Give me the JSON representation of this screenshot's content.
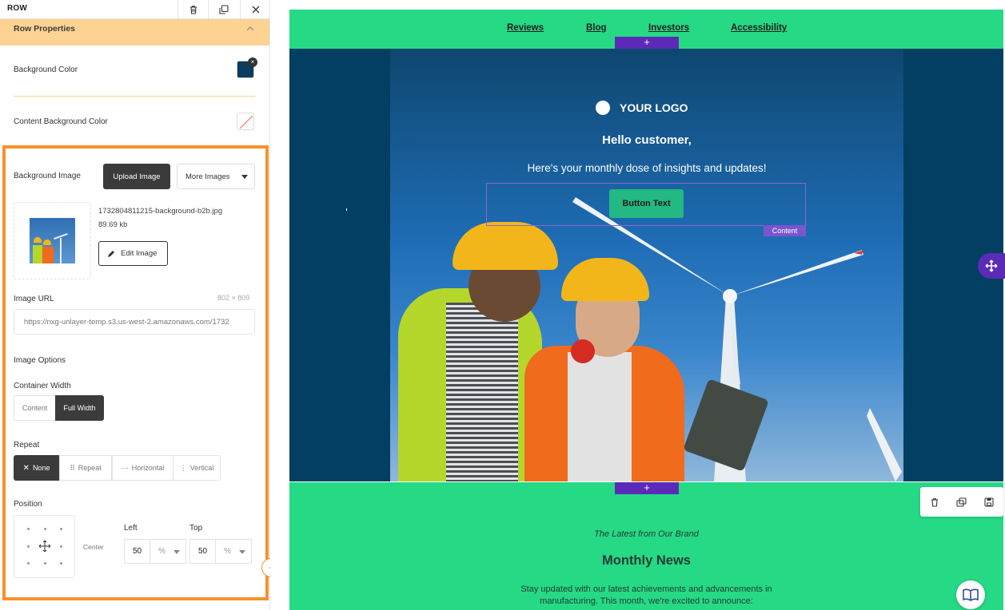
{
  "panel": {
    "title": "ROW",
    "section_title": "Row Properties",
    "background_color_label": "Background Color",
    "background_color_value": "#0b3d5e",
    "content_bg_label": "Content Background Color",
    "bg_image_label": "Background Image",
    "upload_label": "Upload Image",
    "more_images_label": "More Images",
    "file_name": "1732804811215-background-b2b.jpg",
    "file_size": "89.69 kb",
    "edit_image_label": "Edit Image",
    "image_url_label": "Image URL",
    "image_dimensions": "802 × 809",
    "image_url_value": "https://nxg-unlayer-temp.s3.us-west-2.amazonaws.com/1732",
    "image_options_label": "Image Options",
    "container_width_label": "Container Width",
    "container_width_options": [
      "Content",
      "Full Width"
    ],
    "repeat_label": "Repeat",
    "repeat_options": [
      "None",
      "Repeat",
      "Horizontal",
      "Vertical"
    ],
    "position_label": "Position",
    "position_value": "Center",
    "left_label": "Left",
    "top_label": "Top",
    "left_value": "50",
    "top_value": "50",
    "unit": "%"
  },
  "email": {
    "nav": [
      "Reviews",
      "Blog",
      "Investors",
      "Accessibility"
    ],
    "plus": "+",
    "logo_text": "YOUR LOGO",
    "greeting": "Hello customer,",
    "subtitle": "Here's your monthly dose of insights and updates!",
    "button_text": "Button Text",
    "content_tag": "Content",
    "eyebrow": "The Latest from Our Brand",
    "news_title": "Monthly News",
    "body_line1": "Stay updated with our latest achievements and advancements in",
    "body_line2": "manufacturing. This month, we're excited to announce:"
  },
  "colors": {
    "accent_green": "#26d985",
    "hero_navy": "#023f62",
    "purple": "#5b2bb8",
    "orange": "#f6912c",
    "section_peach": "#fcd392"
  }
}
